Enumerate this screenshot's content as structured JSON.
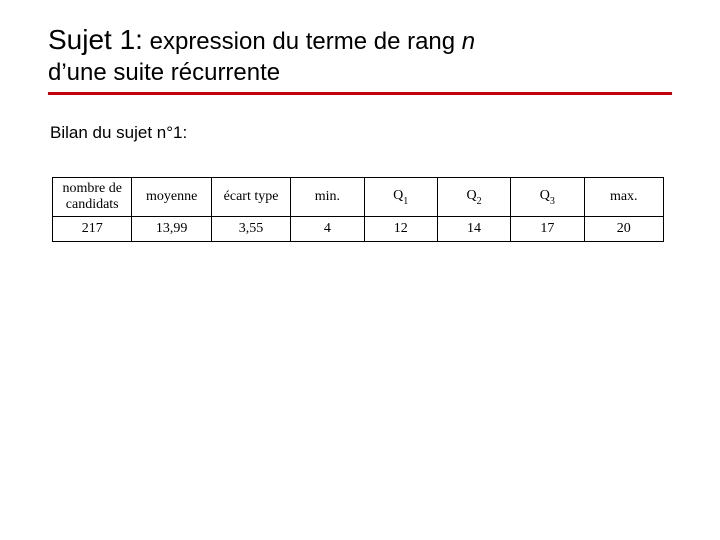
{
  "title": {
    "lead": "Sujet 1:",
    "rest": " expression du terme de rang ",
    "n": "n",
    "sub": "d’une suite récurrente"
  },
  "subhead": "Bilan du sujet n°1:",
  "table": {
    "headers": {
      "h0a": "nombre de",
      "h0b": "candidats",
      "h1": "moyenne",
      "h2": "écart type",
      "h3": "min.",
      "h4a": "Q",
      "h4b": "1",
      "h5a": "Q",
      "h5b": "2",
      "h6a": "Q",
      "h6b": "3",
      "h7": "max."
    },
    "values": {
      "v0": "217",
      "v1": "13,99",
      "v2": "3,55",
      "v3": "4",
      "v4": "12",
      "v5": "14",
      "v6": "17",
      "v7": "20"
    }
  },
  "chart_data": {
    "type": "table",
    "columns": [
      "nombre de candidats",
      "moyenne",
      "écart type",
      "min.",
      "Q1",
      "Q2",
      "Q3",
      "max."
    ],
    "rows": [
      [
        217,
        13.99,
        3.55,
        4,
        12,
        14,
        17,
        20
      ]
    ]
  }
}
